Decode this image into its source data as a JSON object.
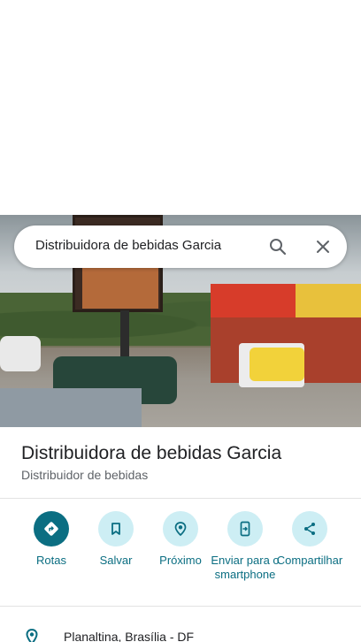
{
  "search": {
    "query": "Distribuidora de bebidas Garcia"
  },
  "place": {
    "name": "Distribuidora de bebidas Garcia",
    "category": "Distribuidor de bebidas",
    "address": "Planaltina, Brasília - DF"
  },
  "actions": [
    {
      "label": "Rotas",
      "icon": "directions-icon"
    },
    {
      "label": "Salvar",
      "icon": "bookmark-icon"
    },
    {
      "label": "Próximo",
      "icon": "nearby-icon"
    },
    {
      "label": "Enviar para o smartphone",
      "icon": "send-to-phone-icon"
    },
    {
      "label": "Compartilhar",
      "icon": "share-icon"
    }
  ],
  "colors": {
    "accent": "#0b6e82",
    "action_bg": "#cdeef4",
    "text_primary": "#202124",
    "text_secondary": "#5f6368"
  }
}
